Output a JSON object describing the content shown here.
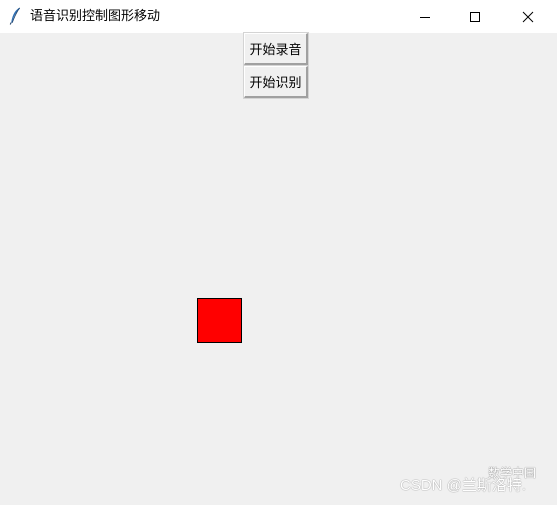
{
  "window": {
    "title": "语音识别控制图形移动",
    "controls": {
      "minimize": "minimize-icon",
      "maximize": "maximize-icon",
      "close": "close-icon"
    }
  },
  "buttons": {
    "record_label": "开始录音",
    "recognize_label": "开始识别"
  },
  "canvas": {
    "shape": "square",
    "fill_color": "#ff0000",
    "border_color": "#000000"
  },
  "watermark": {
    "text": "CSDN @兰斯洛特.",
    "overlay": "数学中国"
  },
  "colors": {
    "window_bg": "#f0f0f0",
    "titlebar_bg": "#ffffff"
  }
}
